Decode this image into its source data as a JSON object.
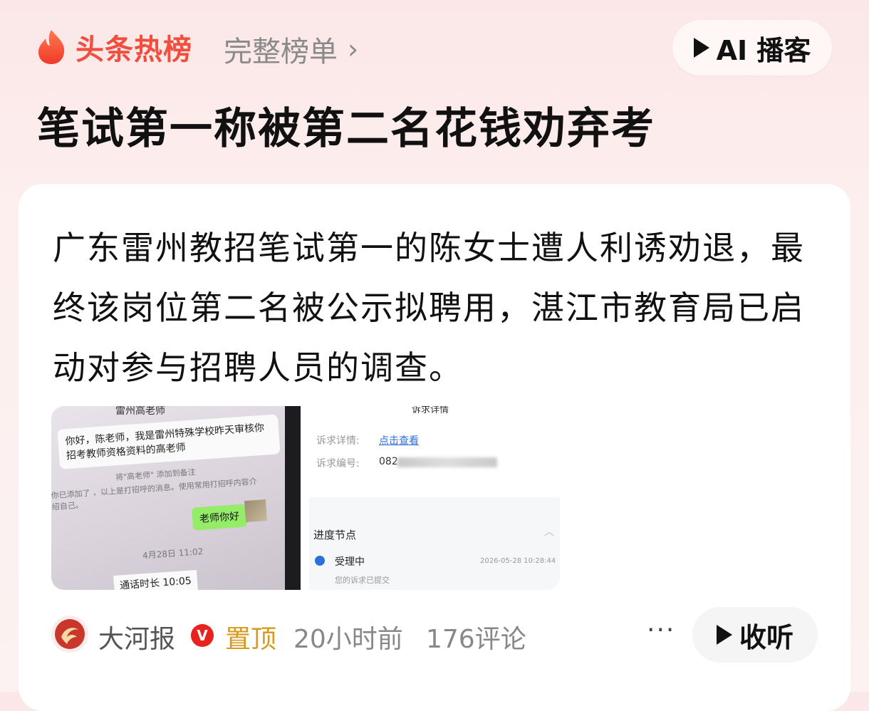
{
  "header": {
    "brand_label": "头条热榜",
    "full_list_label": "完整榜单",
    "ai_button_label": "AI 播客",
    "headline": "笔试第一称被第二名花钱劝弃考"
  },
  "card": {
    "summary": "广东雷州教招笔试第一的陈女士遭人利诱劝退，最终该岗位第二名被公示拟聘用，湛江市教育局已启动对参与招聘人员的调查。",
    "image_left": {
      "chat_header": "雷州高老师",
      "message_1": "你好，陈老师，我是雷州特殊学校昨天审核你招考教师资格资料的高老师",
      "system_1": "将\"高老师\" 添加到备注",
      "system_2": "你已添加了 ，以上是打招呼的消息。使用常用打招呼内容介绍自己。",
      "reply": "老师你好",
      "timestamp": "4月28日 11:02",
      "call_info": "通话时长 10:05"
    },
    "image_right": {
      "page_header": "诉求详情",
      "detail_label": "诉求详情:",
      "detail_link": "点击查看",
      "number_label": "诉求编号:",
      "number_prefix": "082",
      "progress_label": "进度节点",
      "status": "受理中",
      "status_time": "2026-05-28 10:28:44",
      "status_sub": "您的诉求已提交"
    }
  },
  "footer": {
    "source": "大河报",
    "verified_badge": "V",
    "pinned": "置顶",
    "age": "20小时前",
    "comments": "176评论",
    "more": "···",
    "listen_label": "收听"
  }
}
